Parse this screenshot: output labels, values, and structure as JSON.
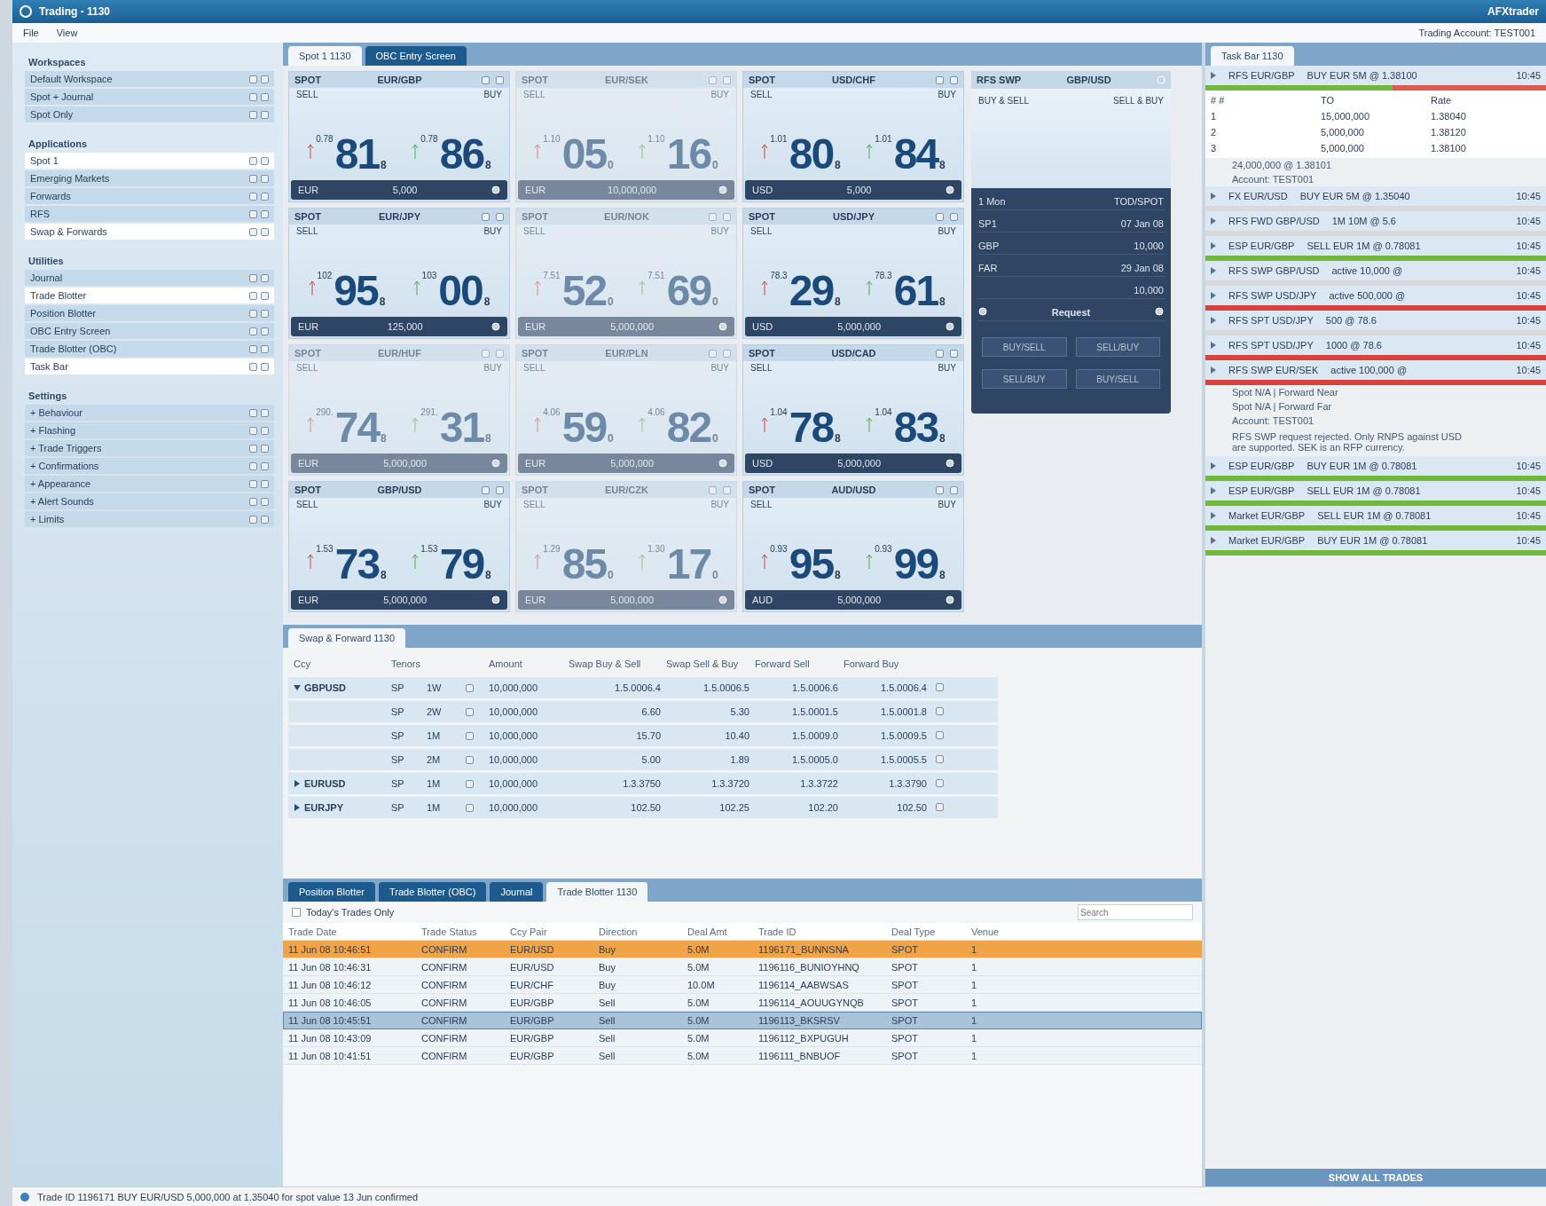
{
  "window": {
    "title": "Trading - 1130",
    "user": "AFXtrader"
  },
  "menu": [
    "File",
    "View"
  ],
  "account": "Trading Account: TEST001",
  "sidebar": {
    "sections": [
      {
        "title": "Workspaces",
        "items": [
          {
            "label": "Default Workspace",
            "selected": false
          },
          {
            "label": "Spot + Journal",
            "selected": false
          },
          {
            "label": "Spot Only",
            "selected": false
          }
        ]
      },
      {
        "title": "Applications",
        "items": [
          {
            "label": "Spot 1",
            "selected": true
          },
          {
            "label": "Emerging Markets",
            "selected": false
          },
          {
            "label": "Forwards",
            "selected": false
          },
          {
            "label": "RFS",
            "selected": false
          },
          {
            "label": "Swap & Forwards",
            "selected": true
          }
        ]
      },
      {
        "title": "Utilities",
        "items": [
          {
            "label": "Journal",
            "selected": false
          },
          {
            "label": "Trade Blotter",
            "selected": true
          },
          {
            "label": "Position Blotter",
            "selected": false
          },
          {
            "label": "OBC Entry Screen",
            "selected": false
          },
          {
            "label": "Trade Blotter (OBC)",
            "selected": false
          },
          {
            "label": "Task Bar",
            "selected": true
          }
        ]
      },
      {
        "title": "Settings",
        "items": [
          {
            "label": "+ Behaviour",
            "selected": false
          },
          {
            "label": "+ Flashing",
            "selected": false
          },
          {
            "label": "+ Trade Triggers",
            "selected": false
          },
          {
            "label": "+ Confirmations",
            "selected": false
          },
          {
            "label": "+ Appearance",
            "selected": false
          },
          {
            "label": "+ Alert Sounds",
            "selected": false
          },
          {
            "label": "+ Limits",
            "selected": false
          }
        ]
      }
    ]
  },
  "workspace_tabs": [
    {
      "label": "Spot 1 1130",
      "selected": true
    },
    {
      "label": "OBC Entry Screen",
      "selected": false
    }
  ],
  "tiles": [
    {
      "type": "SPOT",
      "pair": "EUR/GBP",
      "sell_label": "SELL",
      "buy_label": "BUY",
      "bid_big": "0.78",
      "bid": "81",
      "bid_pip": "8",
      "ask_big": "0.78",
      "ask": "86",
      "ask_pip": "8",
      "stale": false,
      "ccy": "EUR",
      "amount": "5,000"
    },
    {
      "type": "SPOT",
      "pair": "EUR/SEK",
      "sell_label": "SELL",
      "buy_label": "BUY",
      "bid_big": "1.10",
      "bid": "05",
      "bid_pip": "0",
      "ask_big": "1.10",
      "ask": "16",
      "ask_pip": "0",
      "stale": true,
      "ccy": "EUR",
      "amount": "10,000,000"
    },
    {
      "type": "SPOT",
      "pair": "USD/CHF",
      "sell_label": "SELL",
      "buy_label": "BUY",
      "bid_big": "1.01",
      "bid": "80",
      "bid_pip": "8",
      "ask_big": "1.01",
      "ask": "84",
      "ask_pip": "8",
      "stale": false,
      "ccy": "USD",
      "amount": "5,000"
    },
    {
      "type": "SPOT",
      "pair": "EUR/JPY",
      "sell_label": "SELL",
      "buy_label": "BUY",
      "bid_big": "102",
      "bid": "95",
      "bid_pip": "8",
      "ask_big": "103",
      "ask": "00",
      "ask_pip": "8",
      "stale": false,
      "ccy": "EUR",
      "amount": "125,000"
    },
    {
      "type": "SPOT",
      "pair": "EUR/NOK",
      "sell_label": "SELL",
      "buy_label": "BUY",
      "bid_big": "7.51",
      "bid": "52",
      "bid_pip": "0",
      "ask_big": "7.51",
      "ask": "69",
      "ask_pip": "0",
      "stale": true,
      "ccy": "EUR",
      "amount": "5,000,000"
    },
    {
      "type": "SPOT",
      "pair": "USD/JPY",
      "sell_label": "SELL",
      "buy_label": "BUY",
      "bid_big": "78.3",
      "bid": "29",
      "bid_pip": "8",
      "ask_big": "78.3",
      "ask": "61",
      "ask_pip": "8",
      "stale": false,
      "ccy": "USD",
      "amount": "5,000,000"
    },
    {
      "type": "SPOT",
      "pair": "EUR/HUF",
      "sell_label": "SELL",
      "buy_label": "BUY",
      "bid_big": "290.",
      "bid": "74",
      "bid_pip": "8",
      "ask_big": "291.",
      "ask": "31",
      "ask_pip": "8",
      "stale": true,
      "ccy": "EUR",
      "amount": "5,000,000"
    },
    {
      "type": "SPOT",
      "pair": "EUR/PLN",
      "sell_label": "SELL",
      "buy_label": "BUY",
      "bid_big": "4.06",
      "bid": "59",
      "bid_pip": "0",
      "ask_big": "4.06",
      "ask": "82",
      "ask_pip": "0",
      "stale": true,
      "ccy": "EUR",
      "amount": "5,000,000"
    },
    {
      "type": "SPOT",
      "pair": "USD/CAD",
      "sell_label": "SELL",
      "buy_label": "BUY",
      "bid_big": "1.04",
      "bid": "78",
      "bid_pip": "8",
      "ask_big": "1.04",
      "ask": "83",
      "ask_pip": "8",
      "stale": false,
      "ccy": "USD",
      "amount": "5,000,000"
    },
    {
      "type": "SPOT",
      "pair": "GBP/USD",
      "sell_label": "SELL",
      "buy_label": "BUY",
      "bid_big": "1.53",
      "bid": "73",
      "bid_pip": "8",
      "ask_big": "1.53",
      "ask": "79",
      "ask_pip": "8",
      "stale": false,
      "ccy": "EUR",
      "amount": "5,000,000"
    },
    {
      "type": "SPOT",
      "pair": "EUR/CZK",
      "sell_label": "SELL",
      "buy_label": "BUY",
      "bid_big": "1.29",
      "bid": "85",
      "bid_pip": "0",
      "ask_big": "1.30",
      "ask": "17",
      "ask_pip": "0",
      "stale": true,
      "ccy": "EUR",
      "amount": "5,000,000"
    },
    {
      "type": "SPOT",
      "pair": "AUD/USD",
      "sell_label": "SELL",
      "buy_label": "BUY",
      "bid_big": "0.93",
      "bid": "95",
      "bid_pip": "8",
      "ask_big": "0.93",
      "ask": "99",
      "ask_pip": "8",
      "stale": false,
      "ccy": "AUD",
      "amount": "5,000,000"
    }
  ],
  "rfs": {
    "title": "RFS SWP",
    "pair": "GBP/USD",
    "buy_sell": "BUY & SELL",
    "sell_buy": "SELL & BUY",
    "near_tenor": "1 Mon",
    "far_tenor": "TOD/SPOT",
    "rows": [
      {
        "label": "SP1",
        "value": "07 Jan 08"
      },
      {
        "label": "GBP",
        "value": "10,000"
      },
      {
        "label": "FAR",
        "value": "29 Jan 08"
      },
      {
        "label": "",
        "value": "10,000"
      }
    ],
    "request": "Request",
    "buttons": [
      "BUY/SELL",
      "SELL/BUY",
      "SELL/BUY",
      "BUY/SELL"
    ]
  },
  "swap": {
    "tab": "Swap & Forward 1130",
    "columns": [
      "Ccy",
      "Tenors",
      "Amount",
      "Swap Buy & Sell",
      "Swap Sell & Buy",
      "Forward Sell",
      "Forward Buy"
    ],
    "rows": [
      {
        "ccy": "GBPUSD",
        "expanded": true,
        "near": "SP",
        "far": "1W",
        "amount": "10,000,000",
        "cells": [
          "1.5.0006.4",
          "1.5.0006.5",
          "1.5.0006.6",
          "1.5.0006.4"
        ]
      },
      {
        "ccy": "",
        "near": "SP",
        "far": "2W",
        "amount": "10,000,000",
        "cells": [
          "6.60",
          "5.30",
          "1.5.0001.5",
          "1.5.0001.8"
        ]
      },
      {
        "ccy": "",
        "near": "SP",
        "far": "1M",
        "amount": "10,000,000",
        "cells": [
          "15.70",
          "10.40",
          "1.5.0009.0",
          "1.5.0009.5"
        ]
      },
      {
        "ccy": "",
        "near": "SP",
        "far": "2M",
        "amount": "10,000,000",
        "cells": [
          "5.00",
          "1.89",
          "1.5.0005.0",
          "1.5.0005.5"
        ]
      },
      {
        "ccy": "EURUSD",
        "expanded": false,
        "near": "SP",
        "far": "1M",
        "amount": "10,000,000",
        "cells": [
          "1.3.3750",
          "1.3.3720",
          "1.3.3722",
          "1.3.3790"
        ]
      },
      {
        "ccy": "EURJPY",
        "expanded": false,
        "near": "SP",
        "far": "1M",
        "amount": "10,000,000",
        "cells": [
          "102.50",
          "102.25",
          "102.20",
          "102.50"
        ]
      }
    ]
  },
  "trade_bar": {
    "tab": "Task Bar 1130",
    "items": [
      {
        "text": "RFS EUR/GBP",
        "detail": "BUY EUR 5M @ 1.38100",
        "time": "10:45",
        "color": "#6fb83a",
        "level": 0.55
      },
      {
        "text": "FX EUR/USD",
        "detail": "BUY EUR 5M @ 1.35040",
        "time": "10:45",
        "color": "#d9d9d9"
      },
      {
        "text": "RFS FWD GBP/USD",
        "detail": "1M 10M @ 5.6",
        "time": "10:45",
        "color": "#d9d9d9"
      },
      {
        "text": "ESP EUR/GBP",
        "detail": "SELL EUR 1M @ 0.78081",
        "time": "10:45",
        "color": "#6fb83a"
      },
      {
        "text": "RFS SWP GBP/USD",
        "detail": "active 10,000 @",
        "time": "10:45",
        "color": "#d9d9d9"
      },
      {
        "text": "RFS SWP USD/JPY",
        "detail": "active 500,000 @",
        "time": "10:45",
        "color": "#d9413c"
      },
      {
        "text": "RFS SPT USD/JPY",
        "detail": "500 @ 78.6",
        "time": "10:45",
        "color": "#d9d9d9"
      },
      {
        "text": "RFS SPT USD/JPY",
        "detail": "1000 @ 78.6",
        "time": "10:45",
        "color": "#d9413c"
      },
      {
        "text": "RFS SWP EUR/SEK",
        "detail": "active 100,000 @",
        "time": "10:45",
        "color": "#d9413c"
      },
      {
        "text": "ESP EUR/GBP",
        "detail": "BUY EUR 1M @ 0.78081",
        "time": "10:45",
        "color": "#6fb83a"
      },
      {
        "text": "ESP EUR/GBP",
        "detail": "SELL EUR 1M @ 0.78081",
        "time": "10:45",
        "color": "#6fb83a"
      },
      {
        "text": "Market EUR/GBP",
        "detail": "SELL EUR 1M @ 0.78081",
        "time": "10:45",
        "color": "#6fb83a"
      },
      {
        "text": "Market EUR/GBP",
        "detail": "BUY EUR 1M @ 0.78081",
        "time": "10:45",
        "color": "#6fb83a"
      }
    ],
    "ladder": {
      "columns": [
        "# #",
        "TO",
        "Rate"
      ],
      "rows": [
        [
          "1",
          "15,000,000",
          "1.38040"
        ],
        [
          "2",
          "5,000,000",
          "1.38120"
        ],
        [
          "3",
          "5,000,000",
          "1.38100"
        ]
      ]
    },
    "summary": [
      "24,000,000 @ 1.38101",
      "Account: TEST001"
    ],
    "notes": [
      "Spot N/A | Forward Near",
      "Spot N/A | Forward Far",
      "Account: TEST001"
    ],
    "message": "RFS SWP request rejected. Only RNPS against USD are supported. SEK is an RFP currency.",
    "footer": "SHOW ALL TRADES"
  },
  "blotter": {
    "tabs": [
      {
        "label": "Position Blotter",
        "selected": false
      },
      {
        "label": "Trade Blotter (OBC)",
        "selected": false
      },
      {
        "label": "Journal",
        "selected": false
      },
      {
        "label": "Trade Blotter 1130",
        "selected": true
      }
    ],
    "filter": {
      "label": "Today's Trades Only",
      "checked": false
    },
    "search": {
      "placeholder": "Search"
    },
    "columns": [
      "Trade Date",
      "Trade Status",
      "Ccy Pair",
      "Direction",
      "Deal Amt",
      "Trade ID",
      "Deal Type",
      "Venue"
    ],
    "rows": [
      {
        "flash": true,
        "selected": false,
        "cells": [
          "11 Jun 08 10:46:51",
          "CONFIRM",
          "EUR/USD",
          "Buy",
          "5.0M",
          "1196171_BUNNSNA",
          "SPOT",
          "1"
        ]
      },
      {
        "flash": false,
        "selected": false,
        "cells": [
          "11 Jun 08 10:46:31",
          "CONFIRM",
          "EUR/USD",
          "Buy",
          "5.0M",
          "1196116_BUNIOYHNQ",
          "SPOT",
          "1"
        ]
      },
      {
        "flash": false,
        "selected": false,
        "cells": [
          "11 Jun 08 10:46:12",
          "CONFIRM",
          "EUR/CHF",
          "Buy",
          "10.0M",
          "1196114_AABWSAS",
          "SPOT",
          "1"
        ]
      },
      {
        "flash": false,
        "selected": false,
        "cells": [
          "11 Jun 08 10:46:05",
          "CONFIRM",
          "EUR/GBP",
          "Sell",
          "5.0M",
          "1196114_AOUUGYNQB",
          "SPOT",
          "1"
        ]
      },
      {
        "flash": false,
        "selected": true,
        "cells": [
          "11 Jun 08 10:45:51",
          "CONFIRM",
          "EUR/GBP",
          "Sell",
          "5.0M",
          "1196113_BKSRSV",
          "SPOT",
          "1"
        ]
      },
      {
        "flash": false,
        "selected": false,
        "cells": [
          "11 Jun 08 10:43:09",
          "CONFIRM",
          "EUR/GBP",
          "Sell",
          "5.0M",
          "1196112_BXPUGUH",
          "SPOT",
          "1"
        ]
      },
      {
        "flash": false,
        "selected": false,
        "cells": [
          "11 Jun 08 10:41:51",
          "CONFIRM",
          "EUR/GBP",
          "Sell",
          "5.0M",
          "1196111_BNBUOF",
          "SPOT",
          "1"
        ]
      }
    ]
  },
  "status_bar": "Trade ID 1196171 BUY EUR/USD 5,000,000 at 1.35040 for spot value 13 Jun confirmed"
}
